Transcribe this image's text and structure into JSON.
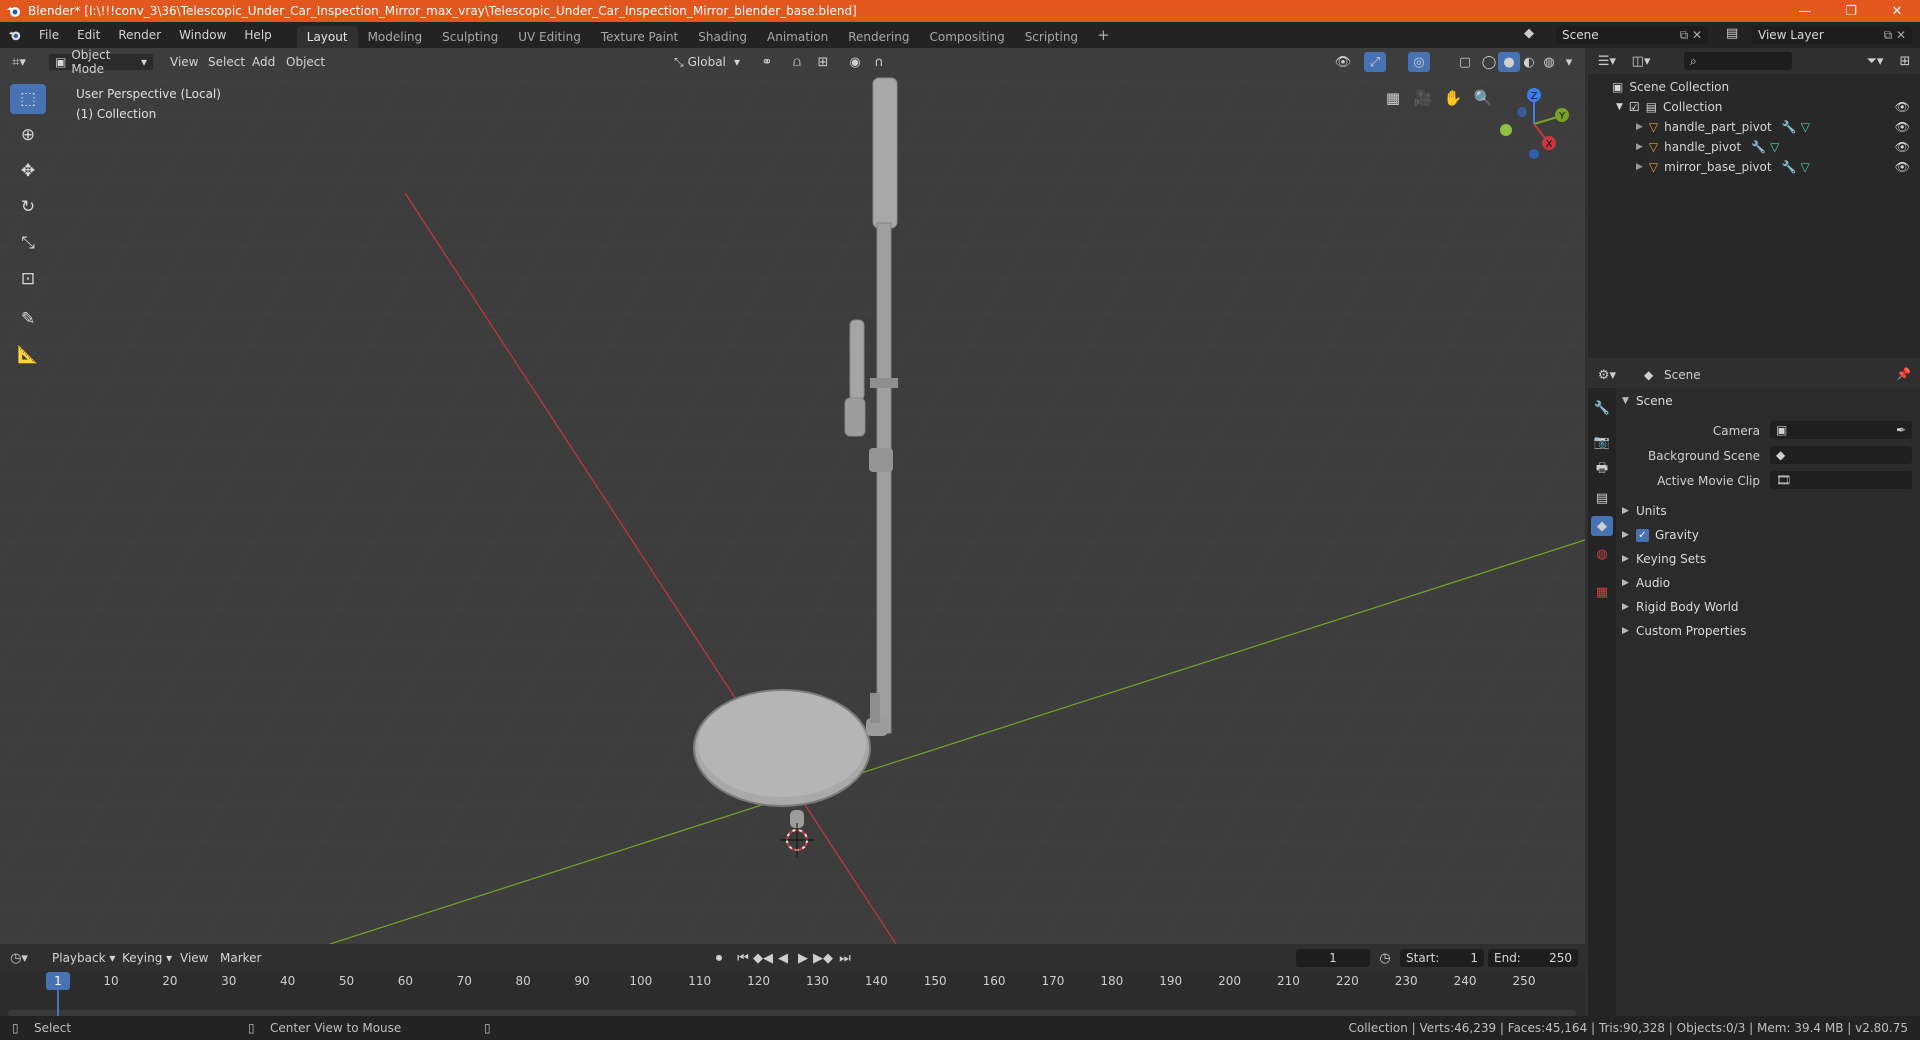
{
  "window": {
    "title": "Blender* [I:\\!!!conv_3\\36\\Telescopic_Under_Car_Inspection_Mirror_max_vray\\Telescopic_Under_Car_Inspection_Mirror_blender_base.blend]",
    "minimize": "—",
    "maximize": "❐",
    "close": "✕"
  },
  "menu": [
    "File",
    "Edit",
    "Render",
    "Window",
    "Help"
  ],
  "workspaces": [
    "Layout",
    "Modeling",
    "Sculpting",
    "UV Editing",
    "Texture Paint",
    "Shading",
    "Animation",
    "Rendering",
    "Compositing",
    "Scripting"
  ],
  "active_workspace": "Layout",
  "add_workspace": "+",
  "scene_selector": "Scene",
  "view_layer_selector": "View Layer",
  "viewport": {
    "mode": "Object Mode",
    "menus": [
      "View",
      "Select",
      "Add",
      "Object"
    ],
    "transform_orientation": "Global",
    "overlay_line1": "User Perspective (Local)",
    "overlay_line2": "(1) Collection",
    "gizmo": {
      "z": "Z",
      "y": "Y",
      "x": "X"
    }
  },
  "outliner": {
    "root": "Scene Collection",
    "collection": "Collection",
    "objects": [
      "handle_part_pivot",
      "handle_pivot",
      "mirror_base_pivot"
    ]
  },
  "properties": {
    "context": "Scene",
    "panel_title": "Scene",
    "camera_label": "Camera",
    "background_scene_label": "Background Scene",
    "active_movie_clip_label": "Active Movie Clip",
    "subpanels": [
      "Units",
      "Gravity",
      "Keying Sets",
      "Audio",
      "Rigid Body World",
      "Custom Properties"
    ],
    "gravity_checked": true
  },
  "timeline": {
    "menus": [
      "Playback",
      "Keying",
      "View",
      "Marker"
    ],
    "current_frame": "1",
    "start_label": "Start:",
    "start_value": "1",
    "end_label": "End:",
    "end_value": "250",
    "ticks": [
      "1",
      "10",
      "20",
      "30",
      "40",
      "50",
      "60",
      "70",
      "80",
      "90",
      "100",
      "110",
      "120",
      "130",
      "140",
      "150",
      "160",
      "170",
      "180",
      "190",
      "200",
      "210",
      "220",
      "230",
      "240",
      "250"
    ]
  },
  "status": {
    "left_action": "Select",
    "middle_action": "Center View to Mouse",
    "stats": "Collection | Verts:46,239 | Faces:45,164 | Tris:90,328 | Objects:0/3 | Mem: 39.4 MB | v2.80.75"
  },
  "colors": {
    "title_bar": "#e2571e",
    "accent": "#4772b3",
    "x_axis": "#c8373f",
    "y_axis": "#7aa324",
    "z_axis": "#3b7ff0"
  }
}
